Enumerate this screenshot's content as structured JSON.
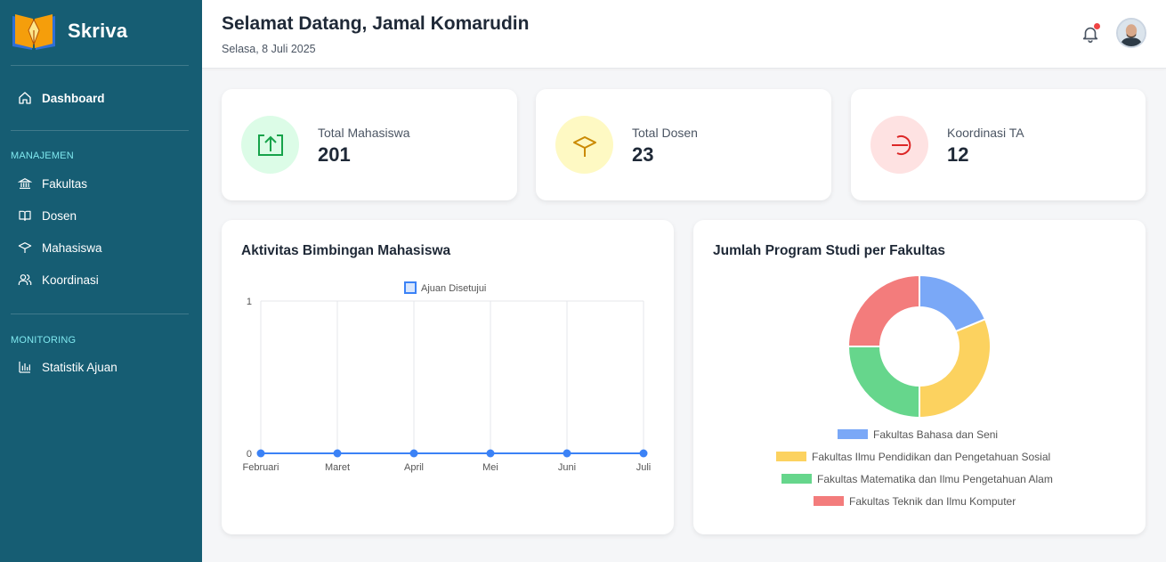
{
  "app": {
    "name": "Skriva"
  },
  "colors": {
    "sidebar": "#165d73",
    "accent": "#3b82f6",
    "section_label": "#7fe8ef"
  },
  "sidebar": {
    "dashboard": {
      "label": "Dashboard",
      "icon": "home-icon"
    },
    "sections": [
      {
        "label": "MANAJEMEN",
        "items": [
          {
            "label": "Fakultas",
            "icon": "building-icon"
          },
          {
            "label": "Dosen",
            "icon": "book-icon"
          },
          {
            "label": "Mahasiswa",
            "icon": "graduation-cap-icon"
          },
          {
            "label": "Koordinasi",
            "icon": "users-icon"
          }
        ]
      },
      {
        "label": "MONITORING",
        "items": [
          {
            "label": "Statistik Ajuan",
            "icon": "bar-chart-icon"
          }
        ]
      }
    ]
  },
  "header": {
    "greeting": "Selamat Datang, Jamal Komarudin",
    "date": "Selasa, 8 Juli 2025",
    "has_notification": true
  },
  "stats": [
    {
      "label": "Total Mahasiswa",
      "value": "201",
      "icon": "upload-box-icon",
      "bg": "#dcfce7",
      "fg": "#16a34a"
    },
    {
      "label": "Total Dosen",
      "value": "23",
      "icon": "graduation-cap-icon",
      "bg": "#fef9c3",
      "fg": "#ca8a04"
    },
    {
      "label": "Koordinasi TA",
      "value": "12",
      "icon": "log-out-icon",
      "bg": "#fee2e2",
      "fg": "#dc2626"
    }
  ],
  "chart_line": {
    "title": "Aktivitas Bimbingan Mahasiswa",
    "chart_data": {
      "type": "line",
      "categories": [
        "Februari",
        "Maret",
        "April",
        "Mei",
        "Juni",
        "Juli"
      ],
      "series": [
        {
          "name": "Ajuan Disetujui",
          "values": [
            0,
            0,
            0,
            0,
            0,
            0
          ],
          "color": "#3b82f6"
        }
      ],
      "ylim": [
        0,
        1
      ],
      "yticks": [
        "0",
        "1"
      ],
      "grid": true,
      "legend": "top"
    }
  },
  "chart_donut": {
    "title": "Jumlah Program Studi per Fakultas",
    "chart_data": {
      "type": "pie",
      "donut": true,
      "categories": [
        "Fakultas Bahasa dan Seni",
        "Fakultas Ilmu Pendidikan dan Pengetahuan Sosial",
        "Fakultas Matematika dan Ilmu Pengetahuan Alam",
        "Fakultas Teknik dan Ilmu Komputer"
      ],
      "values": [
        6,
        10,
        8,
        8
      ],
      "colors": [
        "#7aa8f7",
        "#fcd25f",
        "#66d68c",
        "#f37c7c"
      ],
      "legend": "bottom"
    }
  }
}
